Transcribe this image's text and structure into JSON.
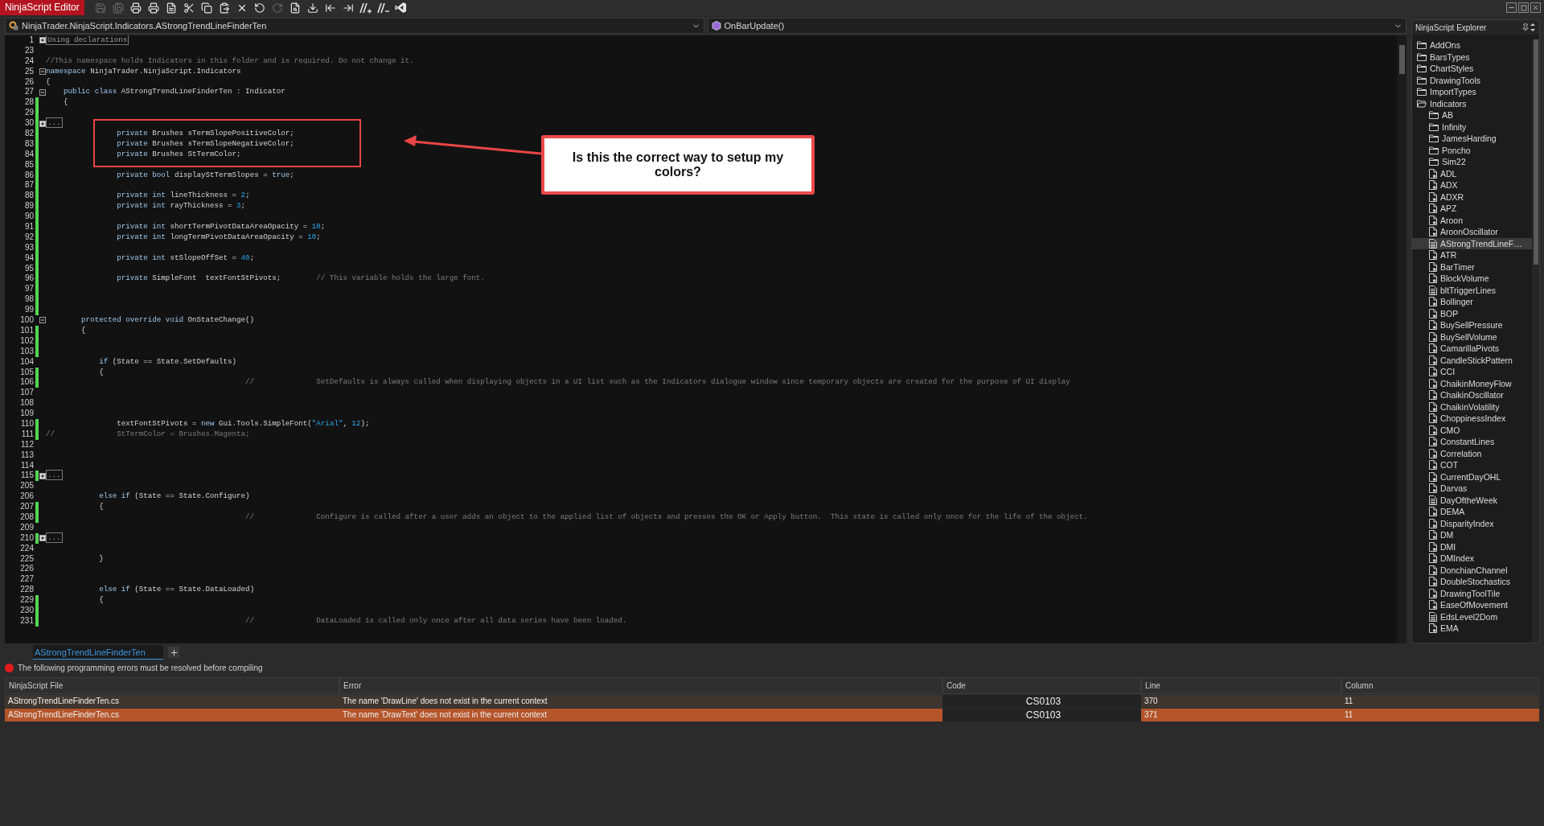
{
  "title_bar": {
    "title": "NinjaScript Editor",
    "tools": [
      {
        "kind": "save",
        "disabled": true
      },
      {
        "kind": "save_all",
        "disabled": true
      },
      {
        "kind": "print",
        "disabled": false
      },
      {
        "kind": "print_preview",
        "disabled": false
      },
      {
        "kind": "properties",
        "disabled": false
      },
      {
        "kind": "cut",
        "disabled": false
      },
      {
        "kind": "copy",
        "disabled": false
      },
      {
        "kind": "paste",
        "disabled": false
      },
      {
        "kind": "delete",
        "disabled": false
      },
      {
        "kind": "undo",
        "disabled": false
      },
      {
        "kind": "redo",
        "disabled": true
      },
      {
        "kind": "find",
        "disabled": false
      },
      {
        "kind": "import",
        "disabled": false
      },
      {
        "kind": "outdent",
        "disabled": false
      },
      {
        "kind": "indent",
        "disabled": false
      },
      {
        "kind": "comment",
        "disabled": false
      },
      {
        "kind": "uncomment",
        "disabled": false
      },
      {
        "kind": "visual_studio",
        "disabled": false
      }
    ]
  },
  "editor": {
    "file_selector": "NinjaTrader.NinjaScript.Indicators.AStrongTrendLineFinderTen",
    "member_selector": "OnBarUpdate()",
    "lines": [
      {
        "number": "1",
        "collapsed": true,
        "changed": false,
        "tokens": [
          {
            "kind": "region",
            "text": "Using declarations"
          }
        ]
      },
      {
        "number": "23",
        "changed": false
      },
      {
        "number": "24",
        "changed": false,
        "tokens": [
          {
            "kind": "comment",
            "text": "//This namespace holds Indicators in this folder and is required. Do not change it."
          }
        ]
      },
      {
        "number": "25",
        "collapsed": false,
        "changed": false,
        "tokens": [
          {
            "kind": "keyword",
            "text": "namespace"
          },
          {
            "kind": "text",
            "text": " NinjaTrader.NinjaScript.Indicators"
          }
        ]
      },
      {
        "number": "26",
        "changed": false,
        "tokens": [
          {
            "kind": "text",
            "text": "{"
          }
        ]
      },
      {
        "number": "27",
        "collapsed": false,
        "changed": false,
        "tokens": [
          {
            "kind": "keyword",
            "text": "    public class"
          },
          {
            "kind": "text",
            "text": " AStrongTrendLineFinderTen : Indicator"
          }
        ]
      },
      {
        "number": "28",
        "changed": true,
        "tokens": [
          {
            "kind": "text",
            "text": "    {"
          }
        ]
      },
      {
        "number": "29",
        "changed": true
      },
      {
        "number": "30",
        "collapsed": true,
        "changed": true,
        "tokens": [
          {
            "kind": "region",
            "text": "..."
          }
        ]
      },
      {
        "number": "82",
        "changed": true,
        "tokens": [
          {
            "kind": "keyword",
            "text": "                private"
          },
          {
            "kind": "text",
            "text": " Brushes sTermSlopePositiveColor;"
          }
        ]
      },
      {
        "number": "83",
        "changed": true,
        "tokens": [
          {
            "kind": "keyword",
            "text": "                private"
          },
          {
            "kind": "text",
            "text": " Brushes sTermSlopeNegativeColor;"
          }
        ]
      },
      {
        "number": "84",
        "changed": true,
        "tokens": [
          {
            "kind": "keyword",
            "text": "                private"
          },
          {
            "kind": "text",
            "text": " Brushes StTermColor;"
          }
        ]
      },
      {
        "number": "85",
        "changed": true
      },
      {
        "number": "86",
        "changed": true,
        "tokens": [
          {
            "kind": "keyword",
            "text": "                private bool"
          },
          {
            "kind": "text",
            "text": " displayStTermSlopes = "
          },
          {
            "kind": "keyword",
            "text": "true"
          },
          {
            "kind": "text",
            "text": ";"
          }
        ]
      },
      {
        "number": "87",
        "changed": true
      },
      {
        "number": "88",
        "changed": true,
        "tokens": [
          {
            "kind": "keyword",
            "text": "                private int"
          },
          {
            "kind": "text",
            "text": " lineThickness = "
          },
          {
            "kind": "number",
            "text": "2"
          },
          {
            "kind": "text",
            "text": ";"
          }
        ]
      },
      {
        "number": "89",
        "changed": true,
        "tokens": [
          {
            "kind": "keyword",
            "text": "                private int"
          },
          {
            "kind": "text",
            "text": " rayThickness = "
          },
          {
            "kind": "number",
            "text": "3"
          },
          {
            "kind": "text",
            "text": ";"
          }
        ]
      },
      {
        "number": "90",
        "changed": true
      },
      {
        "number": "91",
        "changed": true,
        "tokens": [
          {
            "kind": "keyword",
            "text": "                private int"
          },
          {
            "kind": "text",
            "text": " shortTermPivotDataAreaOpacity = "
          },
          {
            "kind": "number",
            "text": "10"
          },
          {
            "kind": "text",
            "text": ";"
          }
        ]
      },
      {
        "number": "92",
        "changed": true,
        "tokens": [
          {
            "kind": "keyword",
            "text": "                private int"
          },
          {
            "kind": "text",
            "text": " longTermPivotDataAreaOpacity = "
          },
          {
            "kind": "number",
            "text": "10"
          },
          {
            "kind": "text",
            "text": ";"
          }
        ]
      },
      {
        "number": "93",
        "changed": true
      },
      {
        "number": "94",
        "changed": true,
        "tokens": [
          {
            "kind": "keyword",
            "text": "                private int"
          },
          {
            "kind": "text",
            "text": " stSlopeOffSet = "
          },
          {
            "kind": "number",
            "text": "40"
          },
          {
            "kind": "text",
            "text": ";"
          }
        ]
      },
      {
        "number": "95",
        "changed": true
      },
      {
        "number": "96",
        "changed": true,
        "tokens": [
          {
            "kind": "keyword",
            "text": "                private"
          },
          {
            "kind": "text",
            "text": " SimpleFont  textFontStPivots;"
          },
          {
            "kind": "comment",
            "text": "        // This variable holds the large font."
          }
        ]
      },
      {
        "number": "97",
        "changed": true
      },
      {
        "number": "98",
        "changed": true
      },
      {
        "number": "99",
        "changed": true
      },
      {
        "number": "100",
        "collapsed": false,
        "changed": false,
        "tokens": [
          {
            "kind": "keyword",
            "text": "        protected override void"
          },
          {
            "kind": "text",
            "text": " OnStateChange()"
          }
        ]
      },
      {
        "number": "101",
        "changed": true,
        "tokens": [
          {
            "kind": "text",
            "text": "        {"
          }
        ]
      },
      {
        "number": "102",
        "changed": true
      },
      {
        "number": "103",
        "changed": true
      },
      {
        "number": "104",
        "changed": false,
        "tokens": [
          {
            "kind": "keyword",
            "text": "            if"
          },
          {
            "kind": "text",
            "text": " (State == State.SetDefaults)"
          }
        ]
      },
      {
        "number": "105",
        "changed": true,
        "tokens": [
          {
            "kind": "text",
            "text": "            {"
          }
        ]
      },
      {
        "number": "106",
        "changed": true,
        "tokens": [
          {
            "kind": "comment",
            "text": "                                             //              SetDefaults is always called when displaying objects in a UI list such as the Indicators dialogue window since temporary objects are created for the purpose of UI display"
          }
        ]
      },
      {
        "number": "107",
        "changed": false
      },
      {
        "number": "108",
        "changed": false
      },
      {
        "number": "109",
        "changed": false
      },
      {
        "number": "110",
        "changed": true,
        "tokens": [
          {
            "kind": "text",
            "text": "                textFontStPivots = "
          },
          {
            "kind": "keyword",
            "text": "new"
          },
          {
            "kind": "text",
            "text": " Gui.Tools.SimpleFont("
          },
          {
            "kind": "string",
            "text": "\"Arial\""
          },
          {
            "kind": "text",
            "text": ", "
          },
          {
            "kind": "number",
            "text": "12"
          },
          {
            "kind": "text",
            "text": ");"
          }
        ]
      },
      {
        "number": "111",
        "changed": true,
        "tokens": [
          {
            "kind": "comment",
            "text": "//              StTermColor = Brushes.Magenta;"
          }
        ]
      },
      {
        "number": "112",
        "changed": false
      },
      {
        "number": "113",
        "changed": false
      },
      {
        "number": "114",
        "changed": false
      },
      {
        "number": "115",
        "collapsed": true,
        "changed": true,
        "tokens": [
          {
            "kind": "region",
            "text": "..."
          }
        ]
      },
      {
        "number": "205",
        "changed": false
      },
      {
        "number": "206",
        "changed": false,
        "tokens": [
          {
            "kind": "keyword",
            "text": "            else if"
          },
          {
            "kind": "text",
            "text": " (State == State.Configure)"
          }
        ]
      },
      {
        "number": "207",
        "changed": true,
        "tokens": [
          {
            "kind": "text",
            "text": "            {"
          }
        ]
      },
      {
        "number": "208",
        "changed": true,
        "tokens": [
          {
            "kind": "comment",
            "text": "                                             //              Configure is called after a user adds an object to the applied list of objects and presses the OK or Apply button.  This state is called only once for the life of the object."
          }
        ]
      },
      {
        "number": "209",
        "changed": false
      },
      {
        "number": "210",
        "collapsed": true,
        "changed": true,
        "tokens": [
          {
            "kind": "region",
            "text": "..."
          }
        ]
      },
      {
        "number": "224",
        "changed": false
      },
      {
        "number": "225",
        "changed": false,
        "tokens": [
          {
            "kind": "text",
            "text": "            }"
          }
        ]
      },
      {
        "number": "226",
        "changed": false
      },
      {
        "number": "227",
        "changed": false
      },
      {
        "number": "228",
        "changed": false,
        "tokens": [
          {
            "kind": "keyword",
            "text": "            else if"
          },
          {
            "kind": "text",
            "text": " (State == State.DataLoaded)"
          }
        ]
      },
      {
        "number": "229",
        "changed": true,
        "tokens": [
          {
            "kind": "text",
            "text": "            {"
          }
        ]
      },
      {
        "number": "230",
        "changed": true
      },
      {
        "number": "231",
        "changed": true,
        "tokens": [
          {
            "kind": "comment",
            "text": "                                             //              DataLoaded is called only once after all data series have been loaded."
          }
        ]
      }
    ]
  },
  "annotation": {
    "callout": "Is this the correct way to setup my colors?"
  },
  "explorer": {
    "title": "NinjaScript Explorer",
    "items": [
      {
        "kind": "folder",
        "label": "AddOns",
        "expanded": false,
        "selected": false
      },
      {
        "kind": "folder",
        "label": "BarsTypes",
        "expanded": false,
        "selected": false
      },
      {
        "kind": "folder",
        "label": "ChartStyles",
        "expanded": false,
        "selected": false
      },
      {
        "kind": "folder",
        "label": "DrawingTools",
        "expanded": false,
        "selected": false
      },
      {
        "kind": "folder",
        "label": "ImportTypes",
        "expanded": false,
        "selected": false
      },
      {
        "kind": "folder",
        "label": "Indicators",
        "expanded": true,
        "selected": false,
        "children": [
          {
            "kind": "folder",
            "label": "AB",
            "expanded": false,
            "selected": false
          },
          {
            "kind": "folder",
            "label": "Infinity",
            "expanded": false,
            "selected": false
          },
          {
            "kind": "folder",
            "label": "JamesHarding",
            "expanded": false,
            "selected": false
          },
          {
            "kind": "folder",
            "label": "Poncho",
            "expanded": false,
            "selected": false
          },
          {
            "kind": "folder",
            "label": "Sim22",
            "expanded": false,
            "selected": false
          },
          {
            "kind": "file",
            "label": "ADL",
            "selected": false
          },
          {
            "kind": "file",
            "label": "ADX",
            "selected": false
          },
          {
            "kind": "file",
            "label": "ADXR",
            "selected": false
          },
          {
            "kind": "file",
            "label": "APZ",
            "selected": false
          },
          {
            "kind": "file",
            "label": "Aroon",
            "selected": false
          },
          {
            "kind": "file",
            "label": "AroonOscillator",
            "selected": false
          },
          {
            "kind": "doc",
            "label": "AStrongTrendLineF…",
            "selected": true
          },
          {
            "kind": "file",
            "label": "ATR",
            "selected": false
          },
          {
            "kind": "file",
            "label": "BarTimer",
            "selected": false
          },
          {
            "kind": "file",
            "label": "BlockVolume",
            "selected": false
          },
          {
            "kind": "doc",
            "label": "bltTriggerLines",
            "selected": false
          },
          {
            "kind": "file",
            "label": "Bollinger",
            "selected": false
          },
          {
            "kind": "file",
            "label": "BOP",
            "selected": false
          },
          {
            "kind": "file",
            "label": "BuySellPressure",
            "selected": false
          },
          {
            "kind": "file",
            "label": "BuySellVolume",
            "selected": false
          },
          {
            "kind": "file",
            "label": "CamarillaPivots",
            "selected": false
          },
          {
            "kind": "file",
            "label": "CandleStickPattern",
            "selected": false
          },
          {
            "kind": "file",
            "label": "CCI",
            "selected": false
          },
          {
            "kind": "file",
            "label": "ChaikinMoneyFlow",
            "selected": false
          },
          {
            "kind": "file",
            "label": "ChaikinOscillator",
            "selected": false
          },
          {
            "kind": "file",
            "label": "ChaikinVolatility",
            "selected": false
          },
          {
            "kind": "file",
            "label": "ChoppinessIndex",
            "selected": false
          },
          {
            "kind": "file",
            "label": "CMO",
            "selected": false
          },
          {
            "kind": "file",
            "label": "ConstantLines",
            "selected": false
          },
          {
            "kind": "file",
            "label": "Correlation",
            "selected": false
          },
          {
            "kind": "file",
            "label": "COT",
            "selected": false
          },
          {
            "kind": "file",
            "label": "CurrentDayOHL",
            "selected": false
          },
          {
            "kind": "file",
            "label": "Darvas",
            "selected": false
          },
          {
            "kind": "doc",
            "label": "DayOftheWeek",
            "selected": false
          },
          {
            "kind": "file",
            "label": "DEMA",
            "selected": false
          },
          {
            "kind": "file",
            "label": "DisparityIndex",
            "selected": false
          },
          {
            "kind": "file",
            "label": "DM",
            "selected": false
          },
          {
            "kind": "file",
            "label": "DMI",
            "selected": false
          },
          {
            "kind": "file",
            "label": "DMIndex",
            "selected": false
          },
          {
            "kind": "file",
            "label": "DonchianChannel",
            "selected": false
          },
          {
            "kind": "file",
            "label": "DoubleStochastics",
            "selected": false
          },
          {
            "kind": "file",
            "label": "DrawingToolTile",
            "selected": false
          },
          {
            "kind": "file",
            "label": "EaseOfMovement",
            "selected": false
          },
          {
            "kind": "doc",
            "label": "EdsLevel2Dom",
            "selected": false
          },
          {
            "kind": "file",
            "label": "EMA",
            "selected": false
          }
        ]
      }
    ]
  },
  "document_tabs": [
    {
      "label": "AStrongTrendLineFinderTen",
      "selected": true
    }
  ],
  "error_panel": {
    "message": "The following programming errors must be resolved before compiling",
    "columns": [
      "NinjaScript File",
      "Error",
      "Code",
      "Line",
      "Column"
    ],
    "rows": [
      {
        "cells": [
          "AStrongTrendLineFinderTen.cs",
          "The name 'DrawLine' does not exist in the current context",
          "CS0103",
          "370",
          "11"
        ],
        "selected": false
      },
      {
        "cells": [
          "AStrongTrendLineFinderTen.cs",
          "The name 'DrawText' does not exist in the current context",
          "CS0103",
          "371",
          "11"
        ],
        "selected": true
      }
    ]
  }
}
